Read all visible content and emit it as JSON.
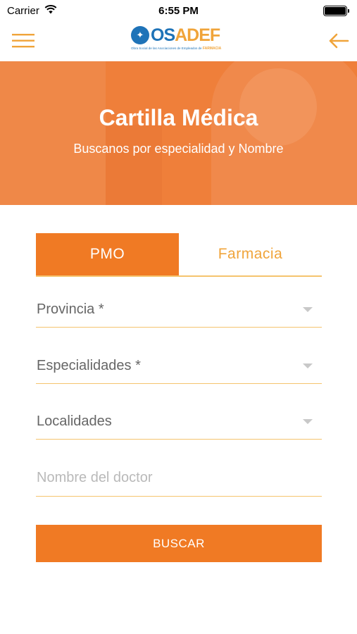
{
  "status_bar": {
    "carrier": "Carrier",
    "time": "6:55 PM",
    "wifi_icon": "wifi-icon",
    "battery_icon": "battery-icon"
  },
  "nav": {
    "menu_icon": "hamburger-menu-icon",
    "back_icon": "arrow-left-icon",
    "logo": {
      "part1": "OS",
      "part2": "ADEF",
      "tagline": "Obra Social de las Asociaciones de Empleados de",
      "tagline_highlight": "FARMACIA"
    },
    "colors": {
      "blue": "#1e73b8",
      "orange": "#f0a43a"
    }
  },
  "hero": {
    "title": "Cartilla Médica",
    "subtitle": "Buscanos por especialidad y Nombre",
    "background": "#ef7f3a"
  },
  "tabs": [
    {
      "label": "PMO",
      "active": true
    },
    {
      "label": "Farmacia",
      "active": false
    }
  ],
  "form": {
    "provincia": "Provincia *",
    "especialidades": "Especialidades *",
    "localidades": "Localidades",
    "doctor_placeholder": "Nombre del doctor",
    "doctor_value": ""
  },
  "search_button": "BUSCAR",
  "accent": "#f07a24"
}
